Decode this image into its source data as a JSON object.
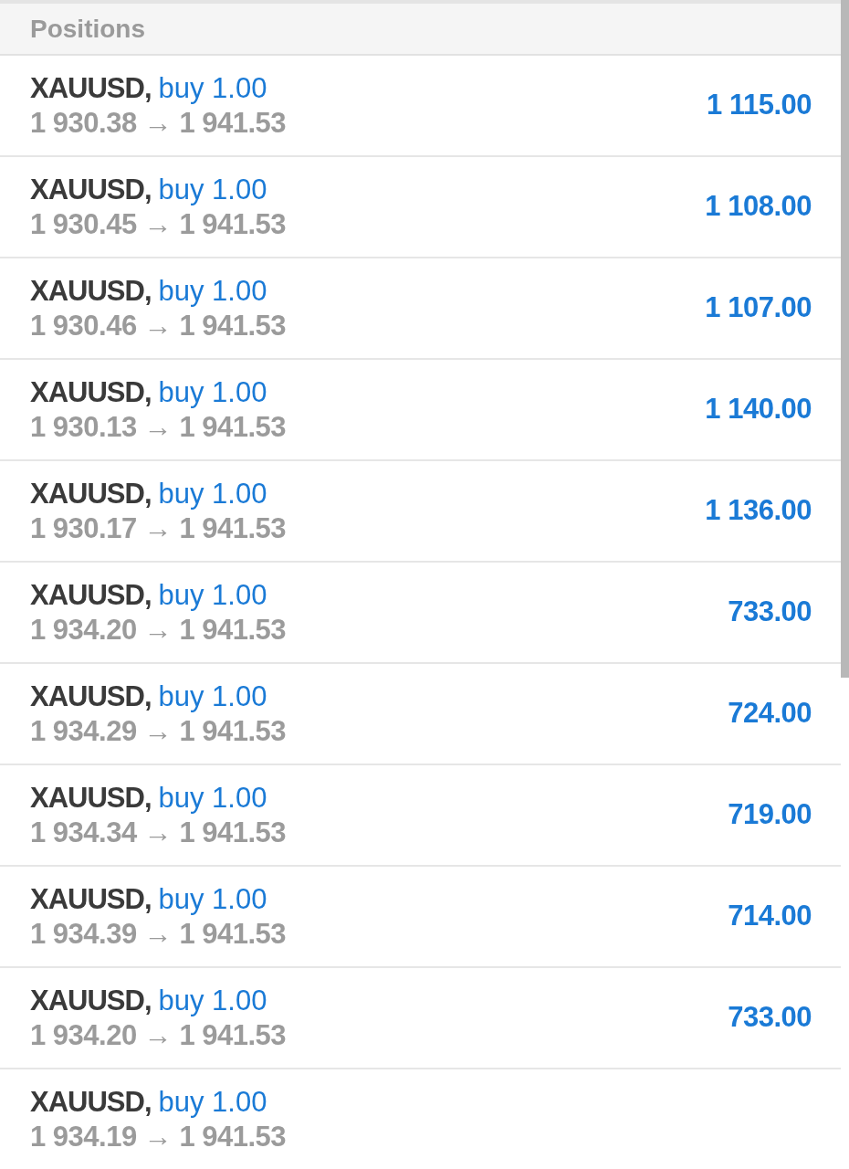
{
  "header": {
    "title": "Positions"
  },
  "positions": [
    {
      "symbol": "XAUUSD,",
      "side": "buy 1.00",
      "prices": "1 930.38 → 1 941.53",
      "profit": "1 115.00"
    },
    {
      "symbol": "XAUUSD,",
      "side": "buy 1.00",
      "prices": "1 930.45 → 1 941.53",
      "profit": "1 108.00"
    },
    {
      "symbol": "XAUUSD,",
      "side": "buy 1.00",
      "prices": "1 930.46 → 1 941.53",
      "profit": "1 107.00"
    },
    {
      "symbol": "XAUUSD,",
      "side": "buy 1.00",
      "prices": "1 930.13 → 1 941.53",
      "profit": "1 140.00"
    },
    {
      "symbol": "XAUUSD,",
      "side": "buy 1.00",
      "prices": "1 930.17 → 1 941.53",
      "profit": "1 136.00"
    },
    {
      "symbol": "XAUUSD,",
      "side": "buy 1.00",
      "prices": "1 934.20 → 1 941.53",
      "profit": "733.00"
    },
    {
      "symbol": "XAUUSD,",
      "side": "buy 1.00",
      "prices": "1 934.29 → 1 941.53",
      "profit": "724.00"
    },
    {
      "symbol": "XAUUSD,",
      "side": "buy 1.00",
      "prices": "1 934.34 → 1 941.53",
      "profit": "719.00"
    },
    {
      "symbol": "XAUUSD,",
      "side": "buy 1.00",
      "prices": "1 934.39 → 1 941.53",
      "profit": "714.00"
    },
    {
      "symbol": "XAUUSD,",
      "side": "buy 1.00",
      "prices": "1 934.20 → 1 941.53",
      "profit": "733.00"
    },
    {
      "symbol": "XAUUSD,",
      "side": "buy 1.00",
      "prices": "1 934.19 → 1 941.53"
    }
  ]
}
